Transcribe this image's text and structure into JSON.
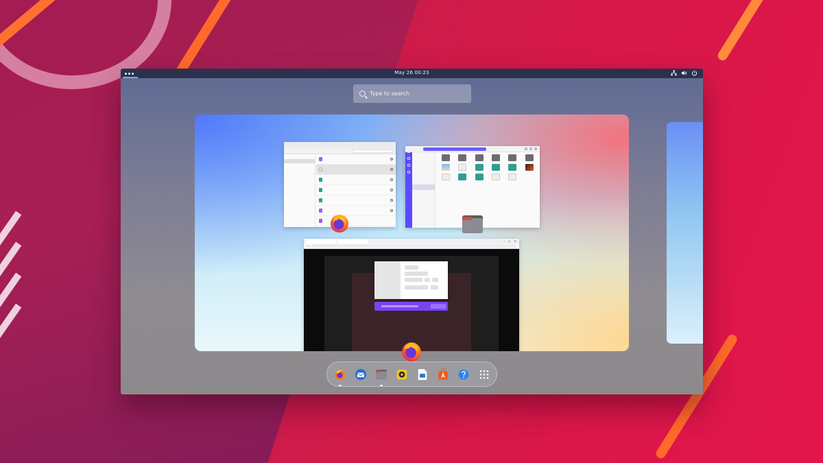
{
  "topbar": {
    "clock": "May 26  00:23",
    "tray_icons": [
      "network-icon",
      "volume-icon",
      "power-icon"
    ]
  },
  "search": {
    "placeholder": "Type to search"
  },
  "colors": {
    "accent": "#6b5cff",
    "firefox_orange": "#ff7a18",
    "firefox_purple": "#7a43f2",
    "wallpaper_red": "#d61848"
  },
  "dash": {
    "apps": [
      {
        "icon": "firefox-icon",
        "running": true
      },
      {
        "icon": "thunderbird-icon",
        "running": false
      },
      {
        "icon": "files-icon",
        "running": true
      },
      {
        "icon": "rhythmbox-icon",
        "running": false
      },
      {
        "icon": "libreoffice-writer-icon",
        "running": false
      },
      {
        "icon": "software-center-icon",
        "running": false
      },
      {
        "icon": "help-icon",
        "running": false
      },
      {
        "icon": "show-apps-grid-icon",
        "running": false
      }
    ]
  }
}
